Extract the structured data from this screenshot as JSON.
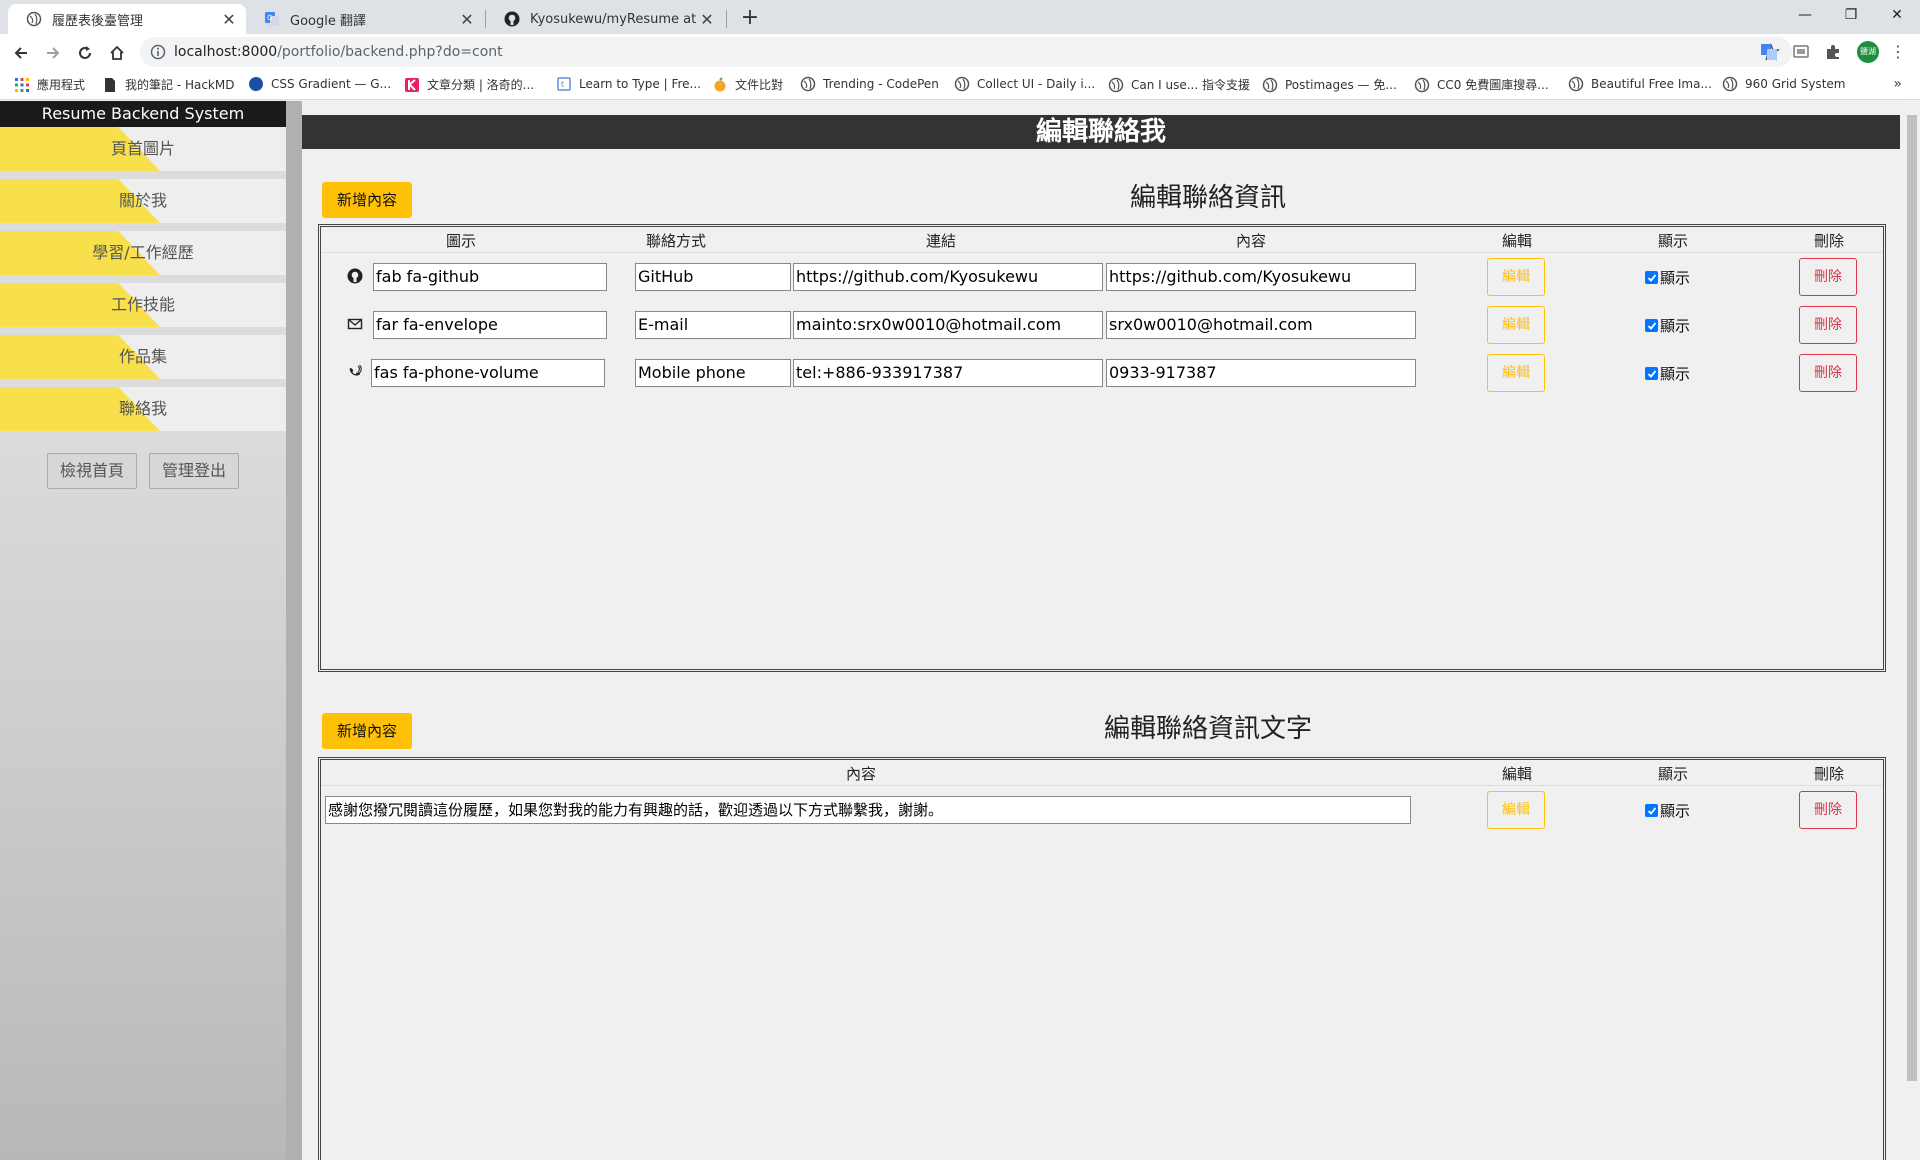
{
  "browser": {
    "tabs": [
      {
        "title": "履歷表後臺管理",
        "active": true
      },
      {
        "title": "Google 翻譯",
        "active": false
      },
      {
        "title": "Kyosukewu/myResume at back",
        "active": false
      }
    ],
    "url_host": "localhost:8000",
    "url_path": "/portfolio/backend.php?do=cont",
    "profile_label": "鹽湖",
    "bookmarks": [
      "應用程式",
      "我的筆記 - HackMD",
      "CSS Gradient — G...",
      "文章分類 | 洛奇的...",
      "Learn to Type | Fre...",
      "文件比對",
      "Trending - CodePen",
      "Collect UI - Daily i...",
      "Can I use... 指令支援",
      "Postimages — 免...",
      "CC0 免費圖庫搜尋...",
      "Beautiful Free Ima...",
      "960 Grid System"
    ]
  },
  "sidebar": {
    "title": "Resume Backend System",
    "items": [
      "頁首圖片",
      "關於我",
      "學習/工作經歷",
      "工作技能",
      "作品集",
      "聯絡我"
    ],
    "buttons": [
      "檢視首頁",
      "管理登出"
    ]
  },
  "main": {
    "page_title": "編輯聯絡我",
    "section1": {
      "add_label": "新增內容",
      "title": "編輯聯絡資訊",
      "headers": {
        "icon": "圖示",
        "method": "聯絡方式",
        "link": "連結",
        "content": "內容",
        "edit": "編輯",
        "show": "顯示",
        "delete": "刪除"
      },
      "rows": [
        {
          "icon_name": "github-icon",
          "icon": "fab fa-github",
          "method": "GitHub",
          "link": "https://github.com/Kyosukewu",
          "content": "https://github.com/Kyosukewu",
          "edit": "編輯",
          "show": "顯示",
          "delete": "刪除"
        },
        {
          "icon_name": "envelope-icon",
          "icon": "far fa-envelope",
          "method": "E-mail",
          "link": "mainto:srx0w0010@hotmail.com",
          "content": "srx0w0010@hotmail.com",
          "edit": "編輯",
          "show": "顯示",
          "delete": "刪除"
        },
        {
          "icon_name": "phone-volume-icon",
          "icon": "fas fa-phone-volume",
          "method": "Mobile phone",
          "link": "tel:+886-933917387",
          "content": "0933-917387",
          "edit": "編輯",
          "show": "顯示",
          "delete": "刪除"
        }
      ]
    },
    "section2": {
      "add_label": "新增內容",
      "title": "編輯聯絡資訊文字",
      "headers": {
        "content": "內容",
        "edit": "編輯",
        "show": "顯示",
        "delete": "刪除"
      },
      "rows": [
        {
          "content": "感謝您撥冗閱讀這份履歷，如果您對我的能力有興趣的話，歡迎透過以下方式聯繫我，謝謝。",
          "edit": "編輯",
          "show": "顯示",
          "delete": "刪除"
        }
      ]
    }
  }
}
